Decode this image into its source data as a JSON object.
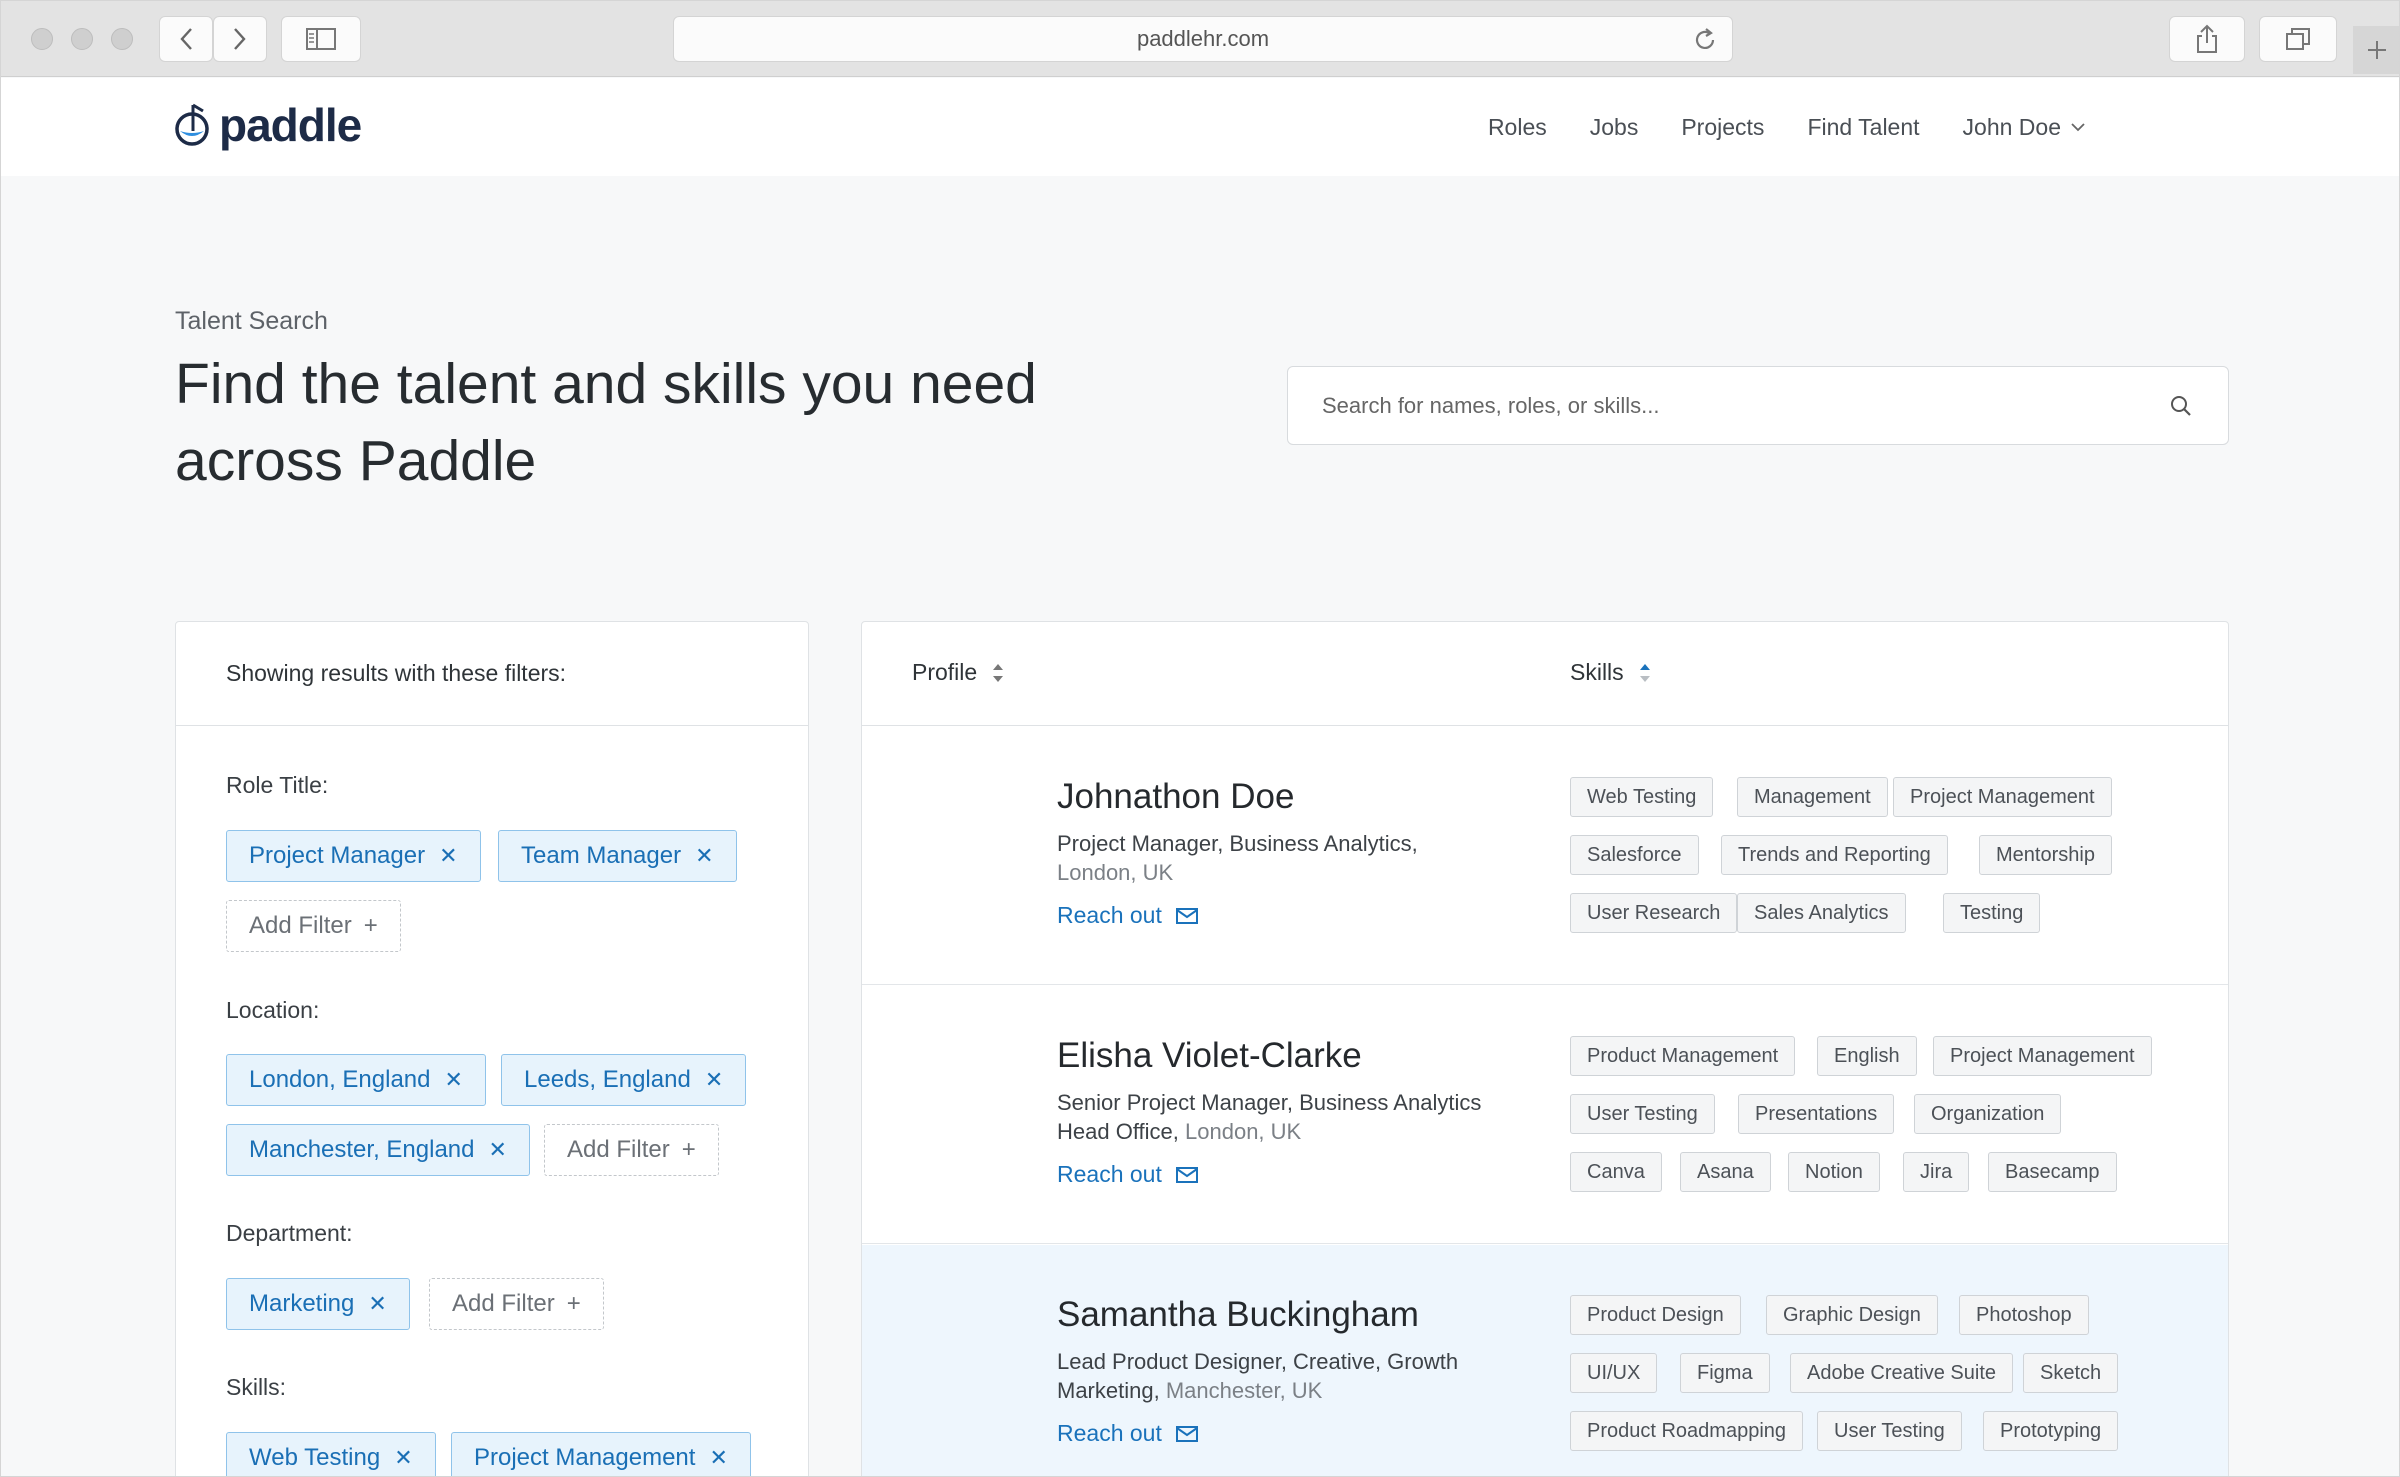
{
  "browser": {
    "url": "paddlehr.com"
  },
  "nav": {
    "brand": "paddle",
    "links": [
      "Roles",
      "Jobs",
      "Projects",
      "Find Talent"
    ],
    "user": "John Doe"
  },
  "hero": {
    "eyebrow": "Talent Search",
    "headline": "Find the talent and skills you need across Paddle",
    "search_placeholder": "Search for names, roles, or skills..."
  },
  "filters": {
    "heading": "Showing results with these filters:",
    "add_label": "Add Filter",
    "groups": [
      {
        "label": "Role Title:",
        "chips": [
          "Project Manager",
          "Team Manager"
        ]
      },
      {
        "label": "Location:",
        "chips": [
          "London, England",
          "Leeds, England",
          "Manchester, England"
        ]
      },
      {
        "label": "Department:",
        "chips": [
          "Marketing"
        ]
      },
      {
        "label": "Skills:",
        "chips": [
          "Web Testing",
          "Project Management"
        ]
      }
    ]
  },
  "results": {
    "columns": {
      "profile": "Profile",
      "skills": "Skills"
    },
    "reach_label": "Reach out",
    "people": [
      {
        "name": "Johnathon Doe",
        "role": "Project Manager, Business Analytics,",
        "location": "London, UK",
        "skills": [
          "Web Testing",
          "Management",
          "Project Management",
          "Salesforce",
          "Trends and Reporting",
          "Mentorship",
          "User Research",
          "Sales Analytics",
          "Testing"
        ]
      },
      {
        "name": "Elisha Violet-Clarke",
        "role": "Senior Project Manager, Business Analytics Head Office,",
        "location": "London, UK",
        "skills": [
          "Product Management",
          "English",
          "Project Management",
          "User Testing",
          "Presentations",
          "Organization",
          "Canva",
          "Asana",
          "Notion",
          "Jira",
          "Basecamp"
        ]
      },
      {
        "name": "Samantha Buckingham",
        "role": "Lead Product Designer, Creative, Growth Marketing,",
        "location": "Manchester, UK",
        "skills": [
          "Product Design",
          "Graphic Design",
          "Photoshop",
          "UI/UX",
          "Figma",
          "Adobe Creative Suite",
          "Sketch",
          "Product Roadmapping",
          "User Testing",
          "Prototyping"
        ]
      }
    ]
  },
  "colors": {
    "accent": "#1a72bb",
    "chip_bg": "#e7f3fc",
    "highlight_row": "#eef6fd",
    "brand_navy": "#1d2b47"
  }
}
